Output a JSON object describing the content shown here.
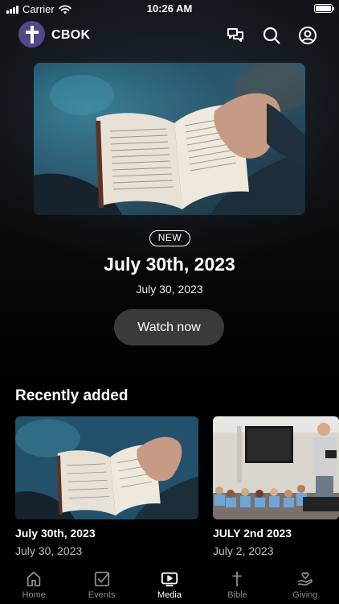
{
  "status_bar": {
    "carrier": "Carrier",
    "time": "10:26 AM"
  },
  "header": {
    "brand": "CBOK",
    "icons": [
      "chat-icon",
      "search-icon",
      "profile-icon"
    ]
  },
  "hero": {
    "badge": "NEW",
    "title": "July 30th, 2023",
    "date": "July 30, 2023",
    "button_label": "Watch now"
  },
  "recently_added": {
    "heading": "Recently added",
    "items": [
      {
        "title": "July 30th, 2023",
        "date": "July 30, 2023"
      },
      {
        "title": "JULY 2nd 2023",
        "date": "July 2, 2023"
      }
    ]
  },
  "tabs": [
    {
      "label": "Home",
      "icon": "home-icon",
      "active": false
    },
    {
      "label": "Events",
      "icon": "checkbox-icon",
      "active": false
    },
    {
      "label": "Media",
      "icon": "play-icon",
      "active": true
    },
    {
      "label": "Bible",
      "icon": "cross-icon",
      "active": false
    },
    {
      "label": "Giving",
      "icon": "giving-hand-icon",
      "active": false
    }
  ],
  "colors": {
    "logo_background": "#4e4a8a",
    "button_background": "#3a3a3c",
    "inactive_tab": "#8a8a8e"
  }
}
